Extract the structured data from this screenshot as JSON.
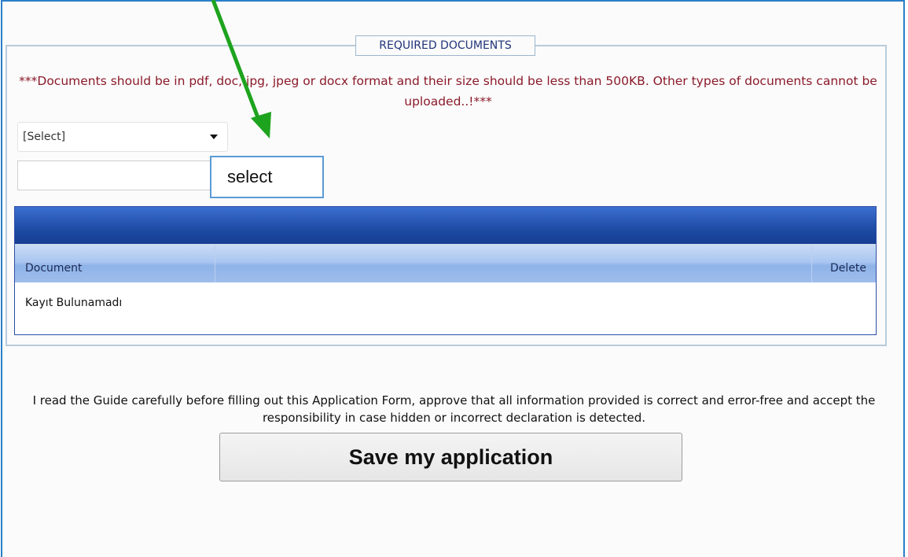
{
  "section": {
    "legend": "REQUIRED DOCUMENTS",
    "warning": "***Documents should be in pdf, doc, jpg, jpeg or docx format and their size should be less than 500KB. Other types of documents cannot be uploaded..!***"
  },
  "document_type_select": {
    "selected": "[Select]"
  },
  "file_input": {
    "value": ""
  },
  "select_button": {
    "label": "select"
  },
  "grid": {
    "columns": [
      "Document",
      "",
      "Delete"
    ],
    "rows": [
      "Kayıt Bulunamadı"
    ]
  },
  "footer": {
    "agreement": "I read the Guide carefully before filling out this Application Form, approve that all information provided is correct and error-free and accept the responsibility in case hidden or incorrect declaration is detected.",
    "save_label": "Save my application"
  },
  "annotation": {
    "arrow_color": "#1ea31e"
  }
}
